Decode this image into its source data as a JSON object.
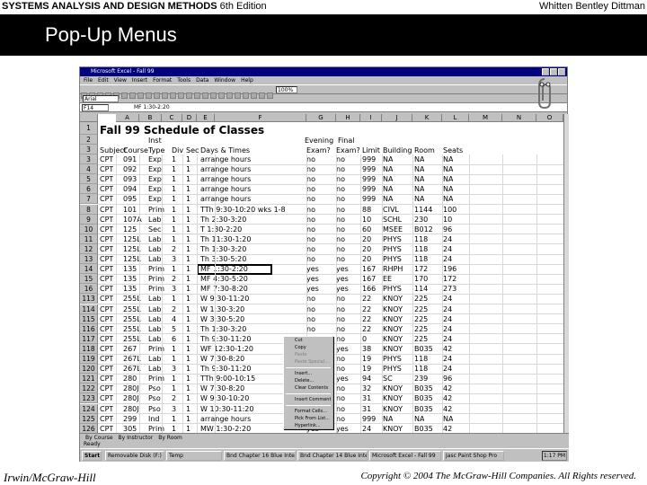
{
  "slide": {
    "header_left_bold": "SYSTEMS ANALYSIS AND DESIGN METHODS",
    "header_left_edition": "6th Edition",
    "header_right": "Whitten   Bentley   Dittman",
    "title": "Pop-Up Menus",
    "footer_left": "Irwin/McGraw-Hill",
    "footer_right": "Copyright © 2004 The McGraw-Hill Companies. All Rights reserved."
  },
  "excel": {
    "window_title": "Microsoft Excel - Fall 99",
    "menus": [
      "File",
      "Edit",
      "View",
      "Insert",
      "Format",
      "Tools",
      "Data",
      "Window",
      "Help"
    ],
    "zoom": "100%",
    "font": "Arial",
    "name_box": "F14",
    "formula": "MF 1:30-2:20",
    "columns": [
      "A",
      "B",
      "C",
      "D",
      "E",
      "F",
      "G",
      "H",
      "I",
      "J",
      "K",
      "L",
      "M",
      "N",
      "O",
      "P"
    ],
    "sheet_title": "Fall 99 Schedule of Classes",
    "header_row_top": {
      "type": "Inst",
      "final": "Final",
      "evening": "Evening"
    },
    "header_row": [
      "Subject",
      "Course",
      "Type",
      "Div",
      "Sec",
      "Days & Times",
      "Exam?",
      "Exam?",
      "Limit",
      "Building",
      "Room",
      "Seats"
    ],
    "rows": [
      {
        "n": "3",
        "c": [
          "CPT",
          "091",
          "Exp",
          "1",
          "1",
          "arrange hours",
          "no",
          "no",
          "999",
          "NA",
          "NA",
          "NA"
        ]
      },
      {
        "n": "4",
        "c": [
          "CPT",
          "092",
          "Exp",
          "1",
          "1",
          "arrange hours",
          "no",
          "no",
          "999",
          "NA",
          "NA",
          "NA"
        ]
      },
      {
        "n": "5",
        "c": [
          "CPT",
          "093",
          "Exp",
          "1",
          "1",
          "arrange hours",
          "no",
          "no",
          "999",
          "NA",
          "NA",
          "NA"
        ]
      },
      {
        "n": "6",
        "c": [
          "CPT",
          "094",
          "Exp",
          "1",
          "1",
          "arrange hours",
          "no",
          "no",
          "999",
          "NA",
          "NA",
          "NA"
        ]
      },
      {
        "n": "7",
        "c": [
          "CPT",
          "095",
          "Exp",
          "1",
          "1",
          "arrange hours",
          "no",
          "no",
          "999",
          "NA",
          "NA",
          "NA"
        ]
      },
      {
        "n": "8",
        "c": [
          "CPT",
          "101",
          "Prim",
          "1",
          "1",
          "TTh 9:30-10:20 wks 1-8",
          "no",
          "no",
          "88",
          "CIVL",
          "1144",
          "100"
        ]
      },
      {
        "n": "9",
        "c": [
          "CPT",
          "107A",
          "Lab",
          "1",
          "1",
          "Th 2:30-3:20",
          "no",
          "no",
          "10",
          "SCHL",
          "230",
          "10"
        ]
      },
      {
        "n": "10",
        "c": [
          "CPT",
          "125",
          "Sec",
          "1",
          "1",
          "T 1:30-2:20",
          "no",
          "no",
          "60",
          "MSEE",
          "B012",
          "96"
        ]
      },
      {
        "n": "11",
        "c": [
          "CPT",
          "125L",
          "Lab",
          "1",
          "1",
          "Th 11:30-1:20",
          "no",
          "no",
          "20",
          "PHYS",
          "118",
          "24"
        ]
      },
      {
        "n": "12",
        "c": [
          "CPT",
          "125L",
          "Lab",
          "2",
          "1",
          "Th 1:30-3:20",
          "no",
          "no",
          "20",
          "PHYS",
          "118",
          "24"
        ]
      },
      {
        "n": "13",
        "c": [
          "CPT",
          "125L",
          "Lab",
          "3",
          "1",
          "Th 3:30-5:20",
          "no",
          "no",
          "20",
          "PHYS",
          "118",
          "24"
        ]
      },
      {
        "n": "14",
        "c": [
          "CPT",
          "135",
          "Prim",
          "1",
          "1",
          "MF 1:30-2:20",
          "yes",
          "yes",
          "167",
          "RHPH",
          "172",
          "196"
        ]
      },
      {
        "n": "15",
        "c": [
          "CPT",
          "135",
          "Prim",
          "2",
          "1",
          "MF 4:30-5:20",
          "yes",
          "yes",
          "167",
          "EE",
          "170",
          "172"
        ]
      },
      {
        "n": "16",
        "c": [
          "CPT",
          "135",
          "Prim",
          "3",
          "1",
          "MF 7:30-8:20",
          "yes",
          "yes",
          "166",
          "PHYS",
          "114",
          "273"
        ]
      },
      {
        "n": "113",
        "c": [
          "CPT",
          "255L",
          "Lab",
          "1",
          "1",
          "W 9:30-11:20",
          "no",
          "no",
          "22",
          "KNOY",
          "225",
          "24"
        ]
      },
      {
        "n": "114",
        "c": [
          "CPT",
          "255L",
          "Lab",
          "2",
          "1",
          "W 1:30-3:20",
          "no",
          "no",
          "22",
          "KNOY",
          "225",
          "24"
        ]
      },
      {
        "n": "115",
        "c": [
          "CPT",
          "255L",
          "Lab",
          "4",
          "1",
          "W 3:30-5:20",
          "no",
          "no",
          "22",
          "KNOY",
          "225",
          "24"
        ]
      },
      {
        "n": "116",
        "c": [
          "CPT",
          "255L",
          "Lab",
          "5",
          "1",
          "Th 1:30-3:20",
          "no",
          "no",
          "22",
          "KNOY",
          "225",
          "24"
        ]
      },
      {
        "n": "117",
        "c": [
          "CPT",
          "255L",
          "Lab",
          "6",
          "1",
          "Th 9:30-11:20",
          "no",
          "no",
          "0",
          "KNOY",
          "225",
          "24"
        ]
      },
      {
        "n": "118",
        "c": [
          "CPT",
          "267",
          "Prim",
          "1",
          "1",
          "WF 12:30-1:20",
          "no",
          "yes",
          "38",
          "KNOY",
          "B035",
          "42"
        ]
      },
      {
        "n": "119",
        "c": [
          "CPT",
          "267L",
          "Lab",
          "1",
          "1",
          "W 7:30-8:20",
          "no",
          "no",
          "19",
          "PHYS",
          "118",
          "24"
        ]
      },
      {
        "n": "120",
        "c": [
          "CPT",
          "267L",
          "Lab",
          "3",
          "1",
          "Th 9:30-11:20",
          "no",
          "no",
          "19",
          "PHYS",
          "118",
          "24"
        ]
      },
      {
        "n": "121",
        "c": [
          "CPT",
          "280",
          "Prim",
          "1",
          "1",
          "TTh 9:00-10:15",
          "no",
          "yes",
          "94",
          "SC",
          "239",
          "96"
        ]
      },
      {
        "n": "122",
        "c": [
          "CPT",
          "280J",
          "Pso",
          "1",
          "1",
          "W 7:30-8:20",
          "no",
          "no",
          "32",
          "KNOY",
          "B035",
          "42"
        ]
      },
      {
        "n": "123",
        "c": [
          "CPT",
          "280J",
          "Pso",
          "2",
          "1",
          "W 9:30-10:20",
          "no",
          "no",
          "31",
          "KNOY",
          "B035",
          "42"
        ]
      },
      {
        "n": "124",
        "c": [
          "CPT",
          "280J",
          "Pso",
          "3",
          "1",
          "W 10:30-11:20",
          "no",
          "no",
          "31",
          "KNOY",
          "B035",
          "42"
        ]
      },
      {
        "n": "125",
        "c": [
          "CPT",
          "299",
          "Ind",
          "1",
          "1",
          "arrange hours",
          "no",
          "no",
          "999",
          "NA",
          "NA",
          "NA"
        ]
      },
      {
        "n": "126",
        "c": [
          "CPT",
          "305",
          "Prim",
          "1",
          "1",
          "MW 1:30-2:20",
          "yes",
          "yes",
          "24",
          "KNOY",
          "B035",
          "42"
        ]
      }
    ],
    "context_menu": [
      {
        "label": "Cut",
        "disabled": false
      },
      {
        "label": "Copy",
        "disabled": false
      },
      {
        "label": "Paste",
        "disabled": true
      },
      {
        "label": "Paste Special...",
        "disabled": true
      },
      {
        "sep": true
      },
      {
        "label": "Insert...",
        "disabled": false
      },
      {
        "label": "Delete...",
        "disabled": false
      },
      {
        "label": "Clear Contents",
        "disabled": false
      },
      {
        "sep": true
      },
      {
        "label": "Insert Comment",
        "disabled": false
      },
      {
        "sep": true
      },
      {
        "label": "Format Cells...",
        "disabled": false
      },
      {
        "label": "Pick From List...",
        "disabled": false
      },
      {
        "label": "Hyperlink...",
        "disabled": false
      }
    ],
    "sheet_tabs": [
      "By Course",
      "By Instructor",
      "By Room"
    ],
    "status": "Ready",
    "taskbar": {
      "start": "Start",
      "tasks": [
        "Removable Disk (F:)",
        "Temp",
        "Bnd Chapter 16 Blue Intel...",
        "Bnd Chapter 14 Blue Intel...",
        "Microsoft Excel - Fall 99",
        "Jasc Paint Shop Pro"
      ],
      "clock": "1:17 PM"
    }
  }
}
